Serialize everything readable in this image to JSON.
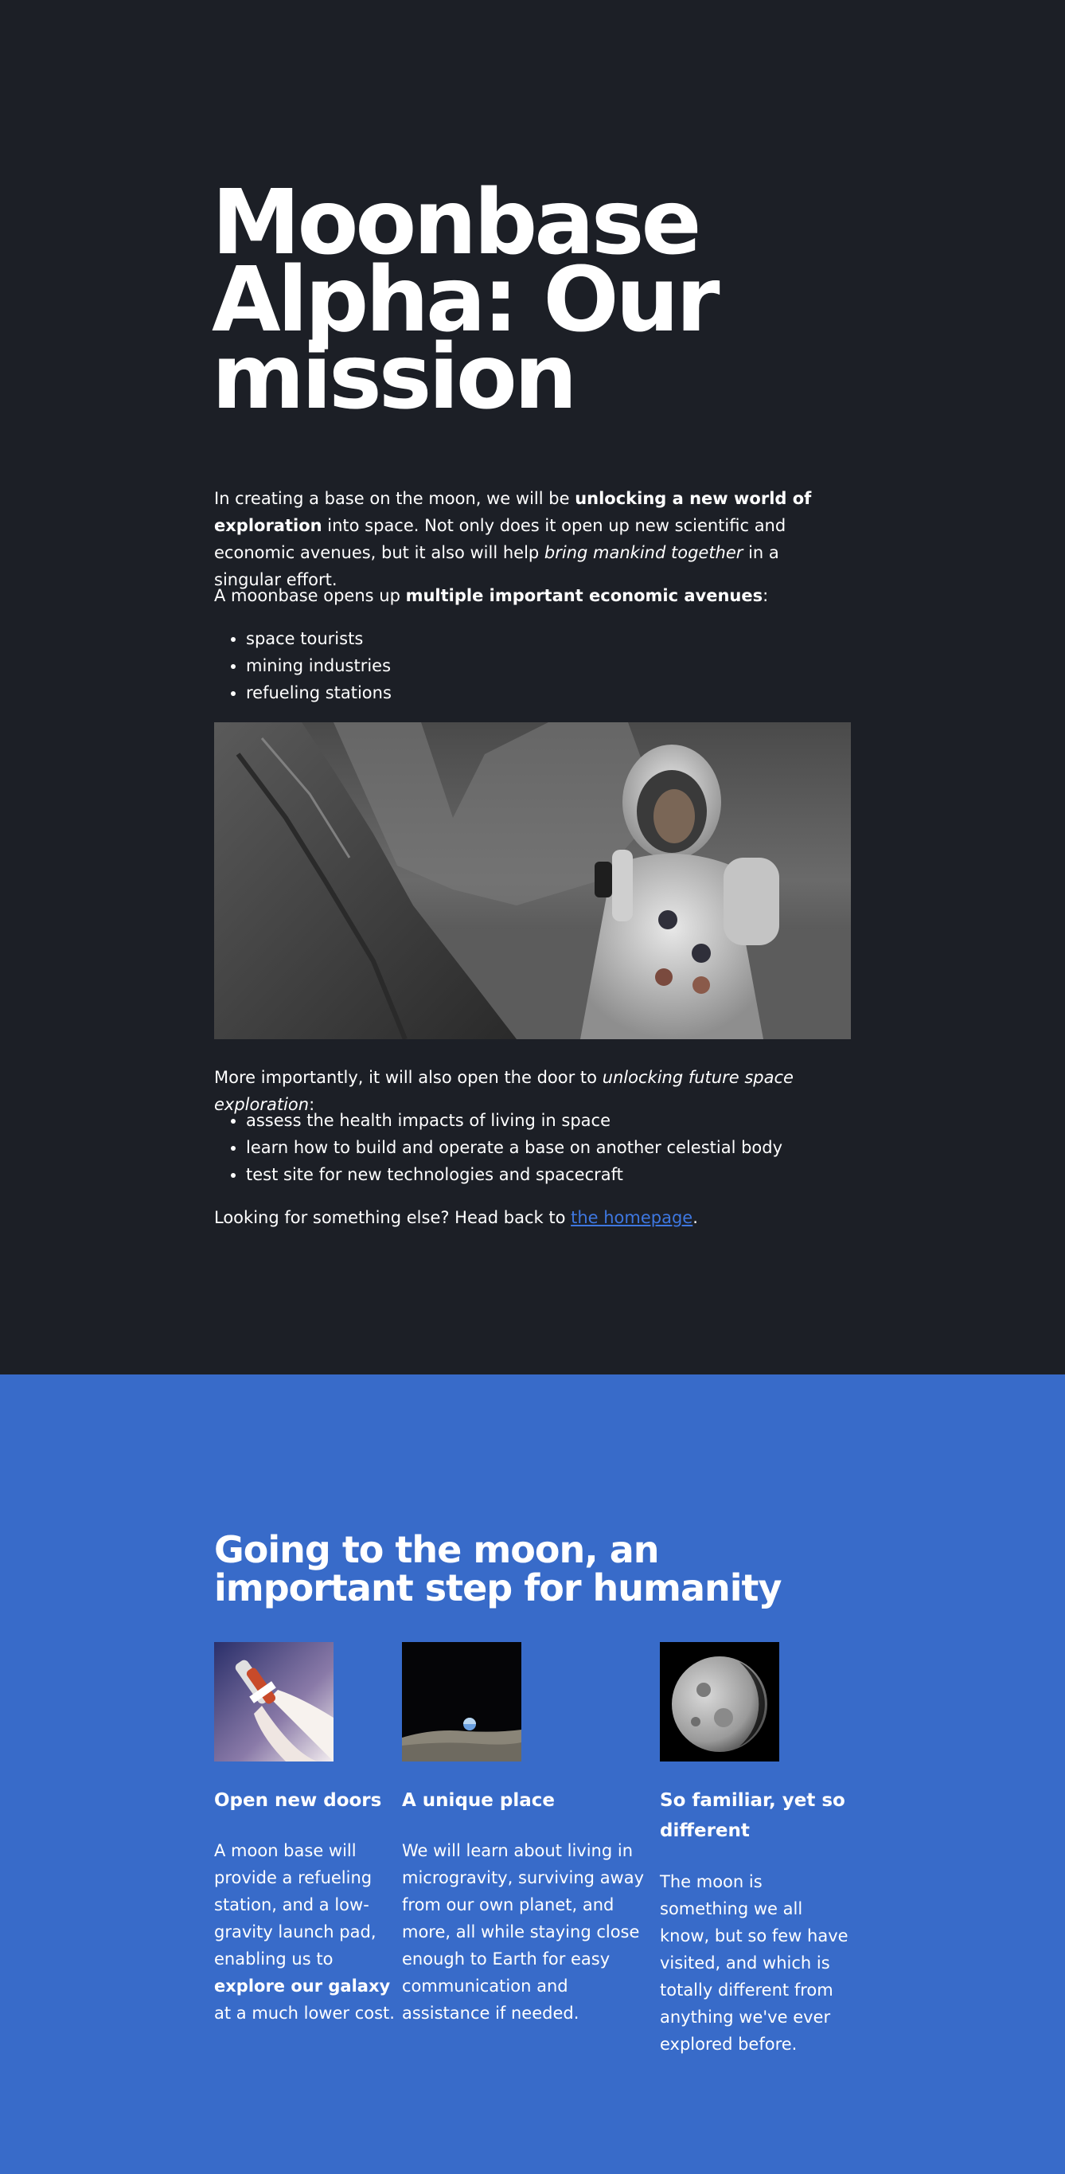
{
  "hero": {
    "title": "Moonbase Alpha: Our mission",
    "intro": {
      "a": "In creating a base on the moon, we will be ",
      "b": "unlocking a new world of exploration",
      "c": " into space. Not only does it open up new scientific and economic avenues, but it also will help ",
      "d": "bring mankind together",
      "e": " in a singular effort."
    },
    "avenues": {
      "a": "A moonbase opens up ",
      "b": "multiple important economic avenues",
      "c": ":"
    },
    "avenue_items": [
      "space tourists",
      "mining industries",
      "refueling stations"
    ],
    "future": {
      "a": "More importantly, it will also open the door to ",
      "b": "unlocking future space exploration",
      "c": ":"
    },
    "future_items": [
      "assess the health impacts of living in space",
      "learn how to build and operate a base on another celestial body",
      "test site for new technologies and spacecraft"
    ],
    "back": {
      "a": "Looking for something else? Head back to ",
      "link": "the homepage",
      "c": "."
    }
  },
  "band": {
    "heading": "Going to the moon, an important step for humanity",
    "cards": [
      {
        "title": "Open new doors",
        "text_a": "A moon base will provide a refueling station, and a low-gravity launch pad, enabling us to ",
        "text_b": "explore our galaxy",
        "text_c": " at a much lower cost."
      },
      {
        "title": "A unique place",
        "text_a": "We will learn about living in microgravity, surviving away from our own planet, and more, all while staying close enough to Earth for easy communication and assistance if needed.",
        "text_b": "",
        "text_c": ""
      },
      {
        "title": "So familiar, yet so different",
        "text_a": "The moon is something we all know, but so few have visited, and which is totally different from anything we've ever explored before.",
        "text_b": "",
        "text_c": ""
      }
    ]
  },
  "colors": {
    "dark_bg": "#1c1f26",
    "band_bg": "#386bc9",
    "link": "#3e77e0"
  }
}
